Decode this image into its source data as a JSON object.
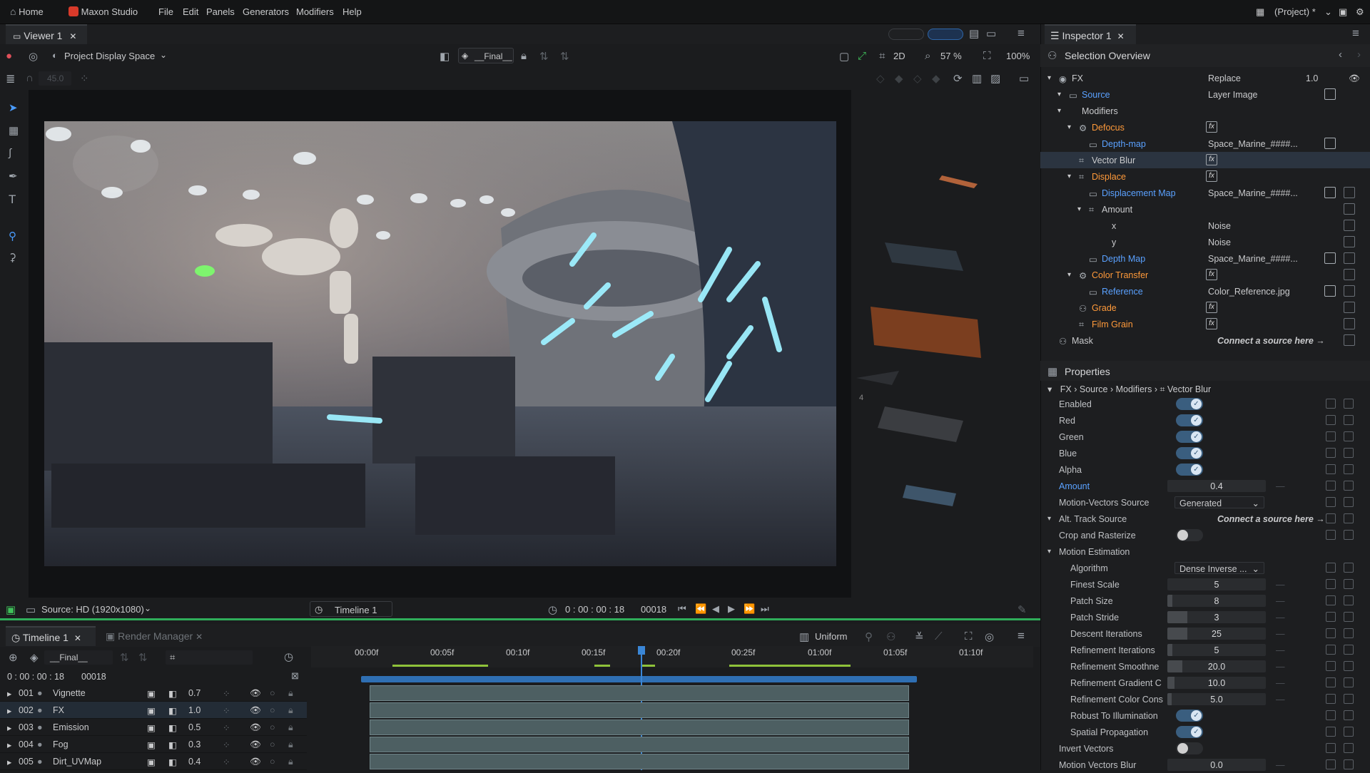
{
  "menubar": {
    "home": "Home",
    "app": "Maxon Studio",
    "menus": [
      "File",
      "Edit",
      "Panels",
      "Generators",
      "Modifiers",
      "Help"
    ],
    "project": "(Project) *"
  },
  "viewer": {
    "tab": "Viewer 1",
    "display_space": "Project Display Space",
    "layer": "__Final__",
    "mode": "2D",
    "zoom": "57 %",
    "scale": "100%",
    "rotation": "45.0",
    "source": "Source: HD (1920x1080)",
    "timeline_select": "Timeline 1",
    "timecode": "0 : 00 : 00 : 18",
    "frame": "00018",
    "side_label": "4"
  },
  "inspector": {
    "tab": "Inspector 1",
    "title": "Selection Overview",
    "rows": [
      {
        "label": "FX",
        "value": "Replace",
        "num": "1.0"
      },
      {
        "label": "Source",
        "value": "Layer Image"
      },
      {
        "label": "Modifiers",
        "value": ""
      },
      {
        "label": "Defocus",
        "value": ""
      },
      {
        "label": "Depth-map",
        "value": "Space_Marine_####..."
      },
      {
        "label": "Vector Blur",
        "value": ""
      },
      {
        "label": "Displace",
        "value": ""
      },
      {
        "label": "Displacement Map",
        "value": "Space_Marine_####..."
      },
      {
        "label": "Amount",
        "value": ""
      },
      {
        "label": "x",
        "value": "Noise"
      },
      {
        "label": "y",
        "value": "Noise"
      },
      {
        "label": "Depth Map",
        "value": "Space_Marine_####..."
      },
      {
        "label": "Color Transfer",
        "value": ""
      },
      {
        "label": "Reference",
        "value": "Color_Reference.jpg"
      },
      {
        "label": "Grade",
        "value": ""
      },
      {
        "label": "Film Grain",
        "value": ""
      },
      {
        "label": "Mask",
        "value": "Connect a source here →"
      }
    ]
  },
  "properties": {
    "title": "Properties",
    "breadcrumb": [
      "FX",
      "Source",
      "Modifiers",
      "Vector Blur"
    ],
    "rows": [
      {
        "label": "Enabled",
        "kind": "toggle",
        "on": true
      },
      {
        "label": "Red",
        "kind": "toggle",
        "on": true
      },
      {
        "label": "Green",
        "kind": "toggle",
        "on": true
      },
      {
        "label": "Blue",
        "kind": "toggle",
        "on": true
      },
      {
        "label": "Alpha",
        "kind": "toggle",
        "on": true
      },
      {
        "label": "Amount",
        "kind": "slider",
        "value": "0.4",
        "fill": 0.0
      },
      {
        "label": "Motion-Vectors Source",
        "kind": "select",
        "value": "Generated"
      },
      {
        "label": "Alt. Track Source",
        "kind": "link",
        "value": "Connect a source here →"
      },
      {
        "label": "Crop and Rasterize",
        "kind": "toggle",
        "on": false
      },
      {
        "label": "Motion Estimation",
        "kind": "group"
      },
      {
        "label": "Algorithm",
        "kind": "select",
        "value": "Dense Inverse ..."
      },
      {
        "label": "Finest Scale",
        "kind": "slider",
        "value": "5",
        "fill": 0.0
      },
      {
        "label": "Patch Size",
        "kind": "slider",
        "value": "8",
        "fill": 0.05
      },
      {
        "label": "Patch Stride",
        "kind": "slider",
        "value": "3",
        "fill": 0.2
      },
      {
        "label": "Descent Iterations",
        "kind": "slider",
        "value": "25",
        "fill": 0.2
      },
      {
        "label": "Refinement Iterations",
        "kind": "slider",
        "value": "5",
        "fill": 0.05
      },
      {
        "label": "Refinement Smoothne",
        "kind": "slider",
        "value": "20.0",
        "fill": 0.15
      },
      {
        "label": "Refinement Gradient C",
        "kind": "slider",
        "value": "10.0",
        "fill": 0.07
      },
      {
        "label": "Refinement Color Cons",
        "kind": "slider",
        "value": "5.0",
        "fill": 0.04
      },
      {
        "label": "Robust To Illumination",
        "kind": "toggle",
        "on": true
      },
      {
        "label": "Spatial Propagation",
        "kind": "toggle",
        "on": true
      },
      {
        "label": "Invert Vectors",
        "kind": "toggle",
        "on": false
      },
      {
        "label": "Motion Vectors Blur",
        "kind": "slider",
        "value": "0.0",
        "fill": 0.0
      }
    ]
  },
  "timeline": {
    "tab": "Timeline 1",
    "tab2": "Render Manager",
    "layer_select": "__Final__",
    "mode": "Uniform",
    "timecode": "0 : 00 : 00 : 18",
    "frame": "00018",
    "ticks": [
      "00:00f",
      "00:05f",
      "00:10f",
      "00:15f",
      "00:20f",
      "00:25f",
      "01:00f",
      "01:05f",
      "01:10f"
    ],
    "layers": [
      {
        "num": "001",
        "name": "Vignette",
        "opacity": "0.7"
      },
      {
        "num": "002",
        "name": "FX",
        "opacity": "1.0"
      },
      {
        "num": "003",
        "name": "Emission",
        "opacity": "0.5"
      },
      {
        "num": "004",
        "name": "Fog",
        "opacity": "0.3"
      },
      {
        "num": "005",
        "name": "Dirt_UVMap",
        "opacity": "0.4"
      }
    ]
  }
}
